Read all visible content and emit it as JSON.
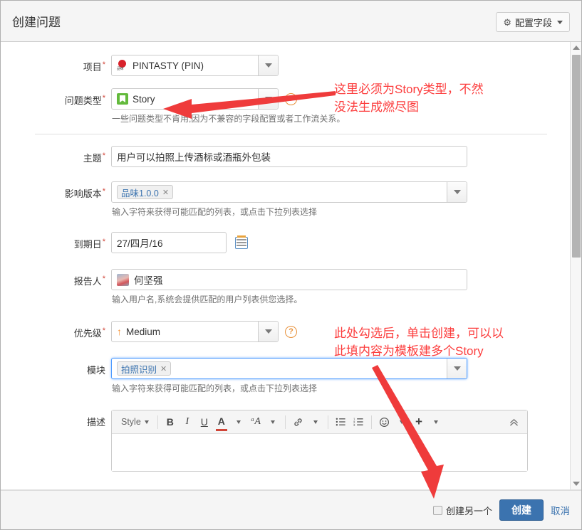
{
  "header": {
    "title": "创建问题",
    "configure_fields_label": "配置字段",
    "gear_icon": "gear-icon",
    "caret_icon": "chevron-down-icon"
  },
  "form": {
    "project": {
      "label": "项目",
      "required": true,
      "value": "PINTASTY (PIN)",
      "icon": "project-avatar-icon"
    },
    "issue_type": {
      "label": "问题类型",
      "required": true,
      "value": "Story",
      "icon": "story-type-icon",
      "help_icon": "question-mark-icon",
      "description": "一些问题类型不肯用,因为不兼容的字段配置或者工作流关系。"
    },
    "summary": {
      "label": "主题",
      "required": true,
      "value": "用户可以拍照上传酒标或酒瓶外包装"
    },
    "affects_version": {
      "label": "影响版本",
      "required": true,
      "tags": [
        "品味1.0.0"
      ],
      "remove_icon": "close-icon",
      "description": "输入字符来获得可能匹配的列表，或点击下拉列表选择"
    },
    "due_date": {
      "label": "到期日",
      "required": true,
      "value": "27/四月/16",
      "calendar_icon": "calendar-icon"
    },
    "reporter": {
      "label": "报告人",
      "required": true,
      "value": "何坚强",
      "avatar": "user-avatar",
      "description": "输入用户名,系统会提供匹配的用户列表供您选择。"
    },
    "priority": {
      "label": "优先级",
      "required": true,
      "value": "Medium",
      "icon": "priority-medium-arrow-icon",
      "help_icon": "question-mark-icon"
    },
    "component": {
      "label": "模块",
      "required": false,
      "tags": [
        "拍照识别"
      ],
      "remove_icon": "close-icon",
      "description": "输入字符来获得可能匹配的列表，或点击下拉列表选择"
    },
    "description": {
      "label": "描述",
      "required": false,
      "value": "",
      "toolbar": {
        "style_label": "Style",
        "bold": "B",
        "italic": "I",
        "underline": "U",
        "text_color": "A",
        "more_color": "chevron-down-icon",
        "text_effects": "ᵃA",
        "link": "🔗",
        "bullet_list": "bullet-list-icon",
        "numbered_list": "numbered-list-icon",
        "emoji": "emoji-icon",
        "insert_more": "+",
        "collapse": "collapse-chevron-icon"
      }
    }
  },
  "footer": {
    "create_another_label": "创建另一个",
    "create_another_checked": false,
    "create_label": "创建",
    "cancel_label": "取消"
  },
  "annotations": [
    {
      "text": "这里必须为Story类型，不然\n没法生成燃尽图"
    },
    {
      "text": "此处勾选后，单击创建，可以以\n此填内容为模板建多个Story"
    }
  ],
  "scrollbar": {
    "up_arrow_icon": "scroll-up-icon",
    "down_arrow_icon": "scroll-down-icon"
  },
  "colors": {
    "annotation_red": "#fc3d3d",
    "primary_button": "#3b73af",
    "story_green": "#63ba3c",
    "priority_orange": "#f79232",
    "required_star": "#d04437"
  }
}
